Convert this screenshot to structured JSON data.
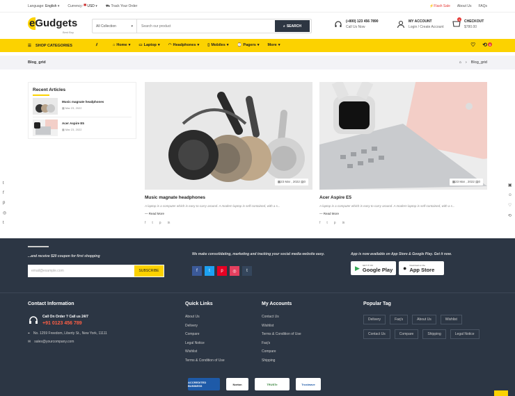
{
  "topbar": {
    "language_label": "Language:",
    "language_value": "English",
    "currency_label": "Currency:",
    "currency_value": "USD",
    "track": "Track Your Order",
    "flash": "Flash Sale",
    "about": "About Us",
    "faqs": "FAQs"
  },
  "logo": {
    "name": "eGudgets",
    "sub": "Best Buy"
  },
  "search": {
    "category": "All Collection",
    "placeholder": "Search our product",
    "button": "SEARCH"
  },
  "support": {
    "phone": "(+800) 123 456 7890",
    "sub": "Call Us Now"
  },
  "account": {
    "title": "MY ACCOUNT",
    "sub": "Login / Create Account"
  },
  "checkout": {
    "title": "CHECKOUT",
    "amount": "$780.00",
    "count": "0"
  },
  "nav": {
    "shop": "SHOP CATEGORIES",
    "items": [
      "Home",
      "Laptop",
      "Headphones",
      "Mobiles",
      "Pagers",
      "More"
    ],
    "compare_count": "0"
  },
  "breadcrumb": {
    "title": "Blog_grid",
    "current": "Blog_grid"
  },
  "recent": {
    "heading": "Recent Articles",
    "items": [
      {
        "name": "Music magnate headphones",
        "date": "Mar 23, 2022"
      },
      {
        "name": "Acer Aspire E5",
        "date": "Mar 23, 2022"
      }
    ]
  },
  "posts": [
    {
      "date": "23 Mar , 2022",
      "comments": "0",
      "title": "Music magnate headphones",
      "excerpt": "A laptop is a computer which is easy to carry around. A modern laptop is self-contained, with a s...",
      "more": "Read More"
    },
    {
      "date": "23 Mar , 2022",
      "comments": "0",
      "title": "Acer Aspire E5",
      "excerpt": "A laptop is a computer which is easy to carry around. A modern laptop is self-contained, with a s...",
      "more": "Read More"
    }
  ],
  "newsletter": {
    "subtitle": "...and receive $20 coupon for first shopping",
    "placeholder": "email@example.com",
    "button": "SUBSCRIBE"
  },
  "social_text": "We make consolidating, marketing and tracking your social media website easy.",
  "app": {
    "text": "App is now available on App Store & Google Play. Get it now.",
    "google_small": "GET IT ON",
    "google": "Google Play",
    "apple_small": "Download on the",
    "apple": "App Store"
  },
  "contact": {
    "heading": "Contact Information",
    "call": "Call On Order ? Call us 24/7",
    "phone": "+91 0123 456 789",
    "address": "No. 1259 Freedom, Liberty St., New York, 11111",
    "email": "sales@yourcompany.com"
  },
  "quick_links": {
    "heading": "Quick Links",
    "items": [
      "About Us",
      "Delivery",
      "Compare",
      "Legal Notice",
      "Wishlist",
      "Terms & Condition of Use"
    ]
  },
  "accounts": {
    "heading": "My Accounts",
    "items": [
      "Contact Us",
      "Wishlist",
      "Terms & Condition of Use",
      "Faq's",
      "Compare",
      "Shipping"
    ]
  },
  "tags": {
    "heading": "Popular Tag",
    "items": [
      "Delivery",
      "Faq's",
      "About Us",
      "Wishlist",
      "Contact Us",
      "Compare",
      "Shipping",
      "Legal Notice"
    ]
  },
  "badges": [
    "ACCREDITED BUSINESS",
    "Norton",
    "TRUSTe",
    "Trustwave"
  ],
  "colors": {
    "accent": "#fcd200",
    "footer": "#2c3644",
    "flash": "#e53935",
    "phone": "#ff5f45"
  }
}
